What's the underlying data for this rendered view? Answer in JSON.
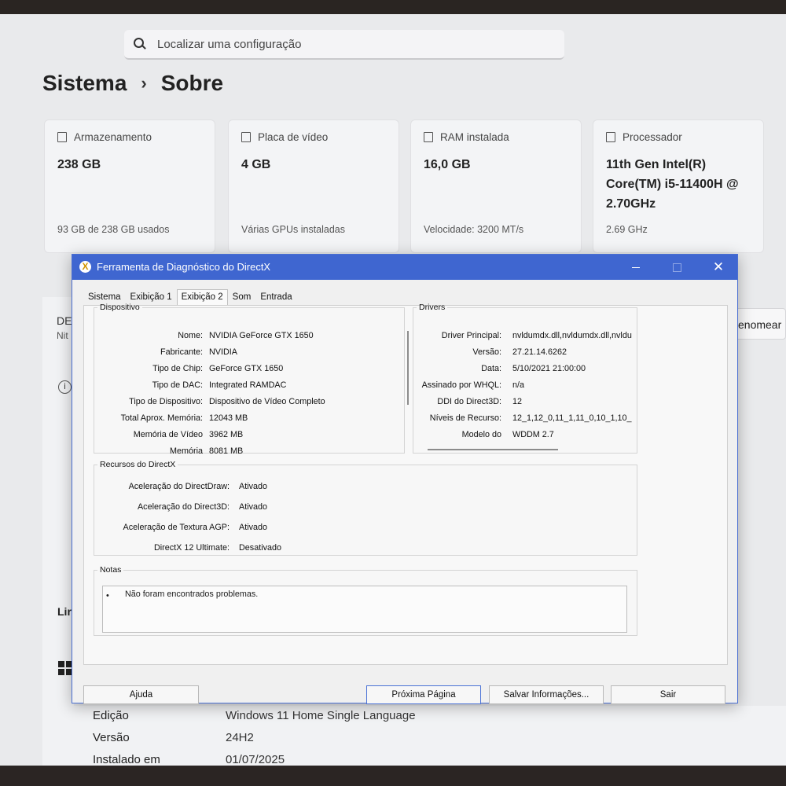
{
  "settings": {
    "search_placeholder": "Localizar uma configuração",
    "breadcrumb": {
      "parent": "Sistema",
      "separator": "›",
      "current": "Sobre"
    },
    "cards": [
      {
        "label": "Armazenamento",
        "value": "238 GB",
        "sub": "93 GB de 238 GB usados"
      },
      {
        "label": "Placa de vídeo",
        "value": "4 GB",
        "sub": "Várias GPUs instaladas"
      },
      {
        "label": "RAM instalada",
        "value": "16,0 GB",
        "sub": "Velocidade: 3200 MT/s"
      },
      {
        "label": "Processador",
        "value": "11th Gen Intel(R) Core(TM) i5-11400H @ 2.70GHz",
        "sub": "2.69 GHz"
      }
    ],
    "device_name_partial": "DE",
    "device_sub_partial": "Nit",
    "rename_button_partial": "enomear",
    "info_icon": "i",
    "section_partial": "Lir",
    "specs": [
      {
        "label": "Edição",
        "value": "Windows 11 Home Single Language"
      },
      {
        "label": "Versão",
        "value": "24H2"
      },
      {
        "label": "Instalado em",
        "value": "01/07/2025"
      }
    ]
  },
  "dialog": {
    "title": "Ferramenta de Diagnóstico do DirectX",
    "app_icon_glyph": "X",
    "window_buttons": {
      "minimize": "",
      "maximize": "",
      "close": "✕"
    },
    "tabs": [
      "Sistema",
      "Exibição 1",
      "Exibição 2",
      "Som",
      "Entrada"
    ],
    "active_tab": "Exibição 2",
    "device": {
      "legend": "Dispositivo",
      "rows": [
        {
          "k": "Nome:",
          "v": "NVIDIA GeForce GTX 1650"
        },
        {
          "k": "Fabricante:",
          "v": "NVIDIA"
        },
        {
          "k": "Tipo de Chip:",
          "v": "GeForce GTX 1650"
        },
        {
          "k": "Tipo de DAC:",
          "v": "Integrated RAMDAC"
        },
        {
          "k": "Tipo de Dispositivo:",
          "v": "Dispositivo de Vídeo Completo"
        },
        {
          "k": "Total Aprox. Memória:",
          "v": "12043 MB"
        },
        {
          "k": "Memória de Vídeo",
          "v": "3962 MB"
        },
        {
          "k": "Memória",
          "v": "8081 MB"
        }
      ]
    },
    "drivers": {
      "legend": "Drivers",
      "rows": [
        {
          "k": "Driver Principal:",
          "v": "nvldumdx.dll,nvldumdx.dll,nvldu"
        },
        {
          "k": "Versão:",
          "v": "27.21.14.6262"
        },
        {
          "k": "Data:",
          "v": "5/10/2021 21:00:00"
        },
        {
          "k": "Assinado por WHQL:",
          "v": "n/a"
        },
        {
          "k": "DDI do Direct3D:",
          "v": "12"
        },
        {
          "k": "Níveis de Recurso:",
          "v": "12_1,12_0,11_1,11_0,10_1,10_"
        },
        {
          "k": "Modelo do",
          "v": "WDDM 2.7"
        }
      ]
    },
    "features": {
      "legend": "Recursos do DirectX",
      "rows": [
        {
          "k": "Aceleração do DirectDraw:",
          "v": "Ativado"
        },
        {
          "k": "Aceleração do Direct3D:",
          "v": "Ativado"
        },
        {
          "k": "Aceleração de Textura AGP:",
          "v": "Ativado"
        },
        {
          "k": "DirectX 12 Ultimate:",
          "v": "Desativado"
        }
      ]
    },
    "notes": {
      "legend": "Notas",
      "bullet": "•",
      "text": "Não foram encontrados problemas."
    },
    "buttons": {
      "help": "Ajuda",
      "next": "Próxima Página",
      "save": "Salvar Informações...",
      "exit": "Sair"
    }
  }
}
